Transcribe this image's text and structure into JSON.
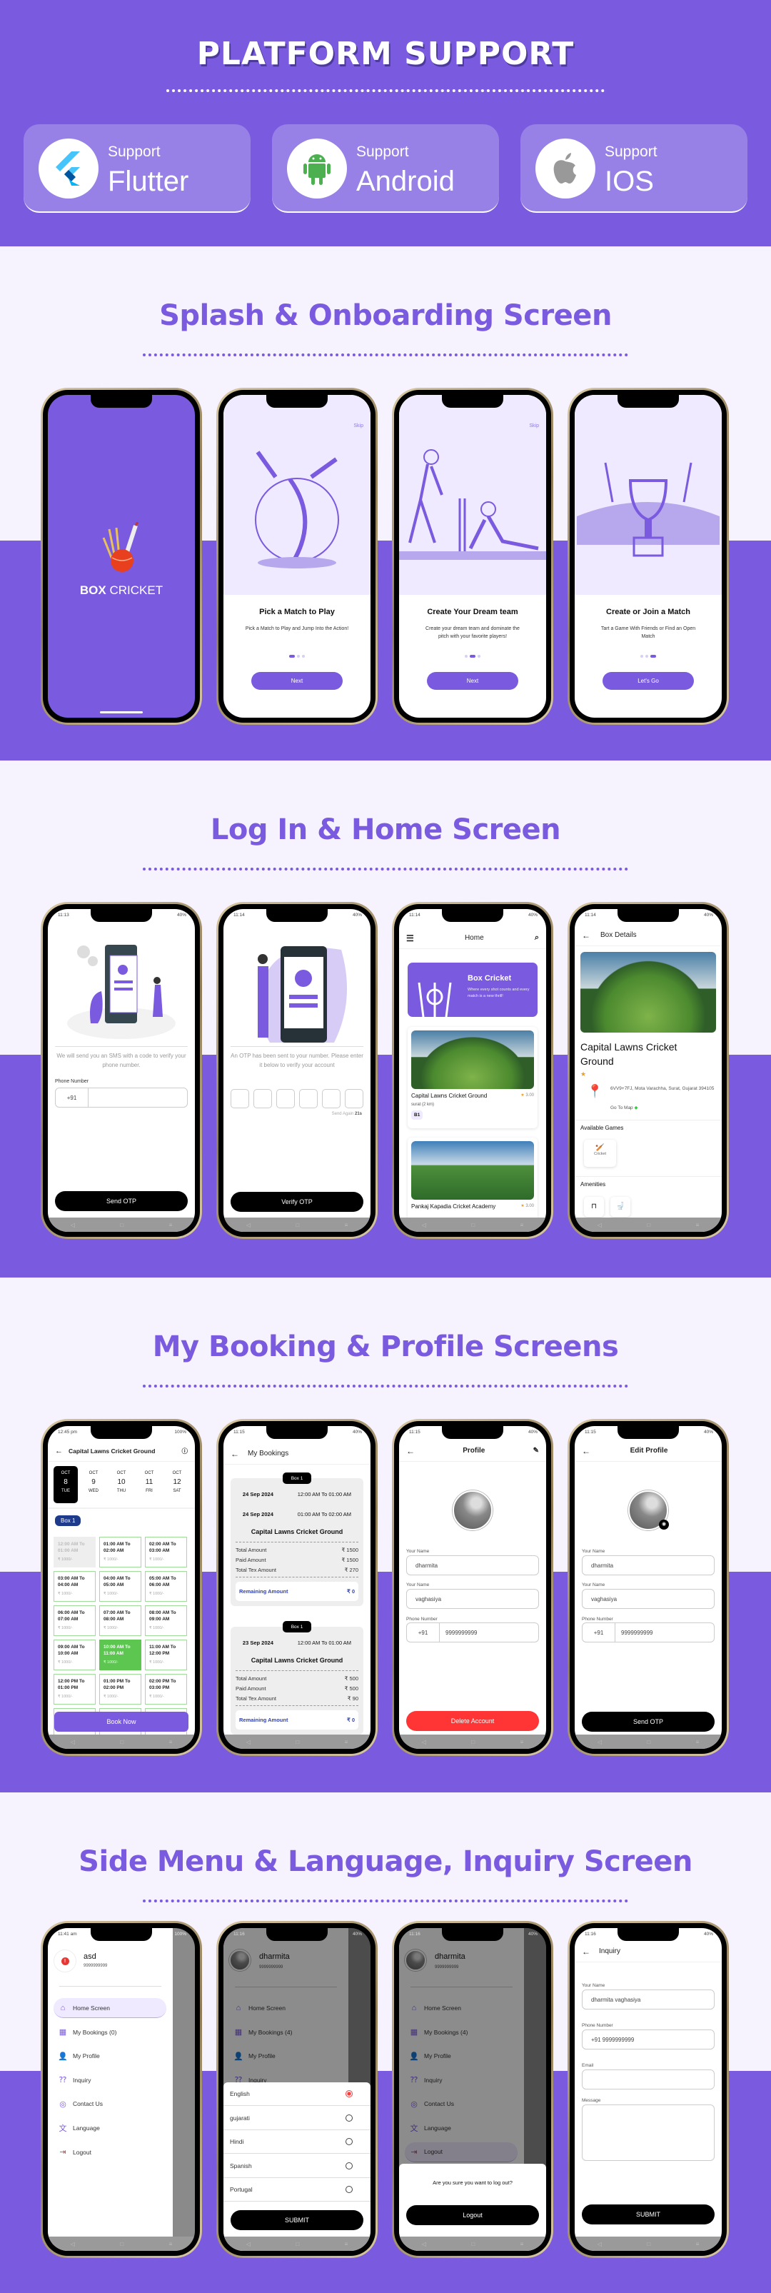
{
  "colors": {
    "primary": "#7a5ade",
    "light_bg": "#f6f3ff",
    "danger": "#ff3434",
    "slot_selected": "#5cc651"
  },
  "platform": {
    "title": "PLATFORM SUPPORT",
    "cards": [
      {
        "label": "Support",
        "name": "Flutter",
        "icon": "flutter-logo"
      },
      {
        "label": "Support",
        "name": "Android",
        "icon": "android-logo"
      },
      {
        "label": "Support",
        "name": "IOS",
        "icon": "apple-logo"
      }
    ]
  },
  "sections": [
    "Splash & Onboarding Screen",
    "Log In & Home Screen",
    "My Booking & Profile Screens",
    "Side Menu & Language, Inquiry Screen"
  ],
  "splash": {
    "brand_bold": "BOX",
    "brand_light": "CRICKET"
  },
  "onboarding": [
    {
      "skip": "Skip",
      "title": "Pick a Match to Play",
      "desc": "Pick a Match to Play and Jump Into the Action!",
      "button": "Next",
      "active_dot": 1
    },
    {
      "skip": "Skip",
      "title": "Create Your Dream team",
      "desc": "Create your dream team and dominate the pitch with your favorite players!",
      "button": "Next",
      "active_dot": 2
    },
    {
      "title": "Create or Join a Match",
      "desc": "Tart a Game With Friends or Find an Open Match",
      "button": "Let's Go",
      "active_dot": 3
    }
  ],
  "login": {
    "time": "11:13",
    "battery": "40%",
    "message": "We will send you an SMS with a code to verify your phone number.",
    "phone_label": "Phone Number",
    "country_code": "+91",
    "button": "Send OTP"
  },
  "otp": {
    "time": "11:14",
    "battery": "40%",
    "message": "An OTP has been sent to your number. Please enter it below to verify your account",
    "resend_label": "Send Again",
    "resend_timer": "21s",
    "button": "Verify OTP"
  },
  "home": {
    "time": "11:14",
    "battery": "40%",
    "title": "Home",
    "banner_title": "Box Cricket",
    "banner_text": "Where every shot counts and every match is a new thrill!",
    "grounds": [
      {
        "name": "Capital Lawns Cricket Ground",
        "rating": "3.00",
        "location": "surat (2 km)",
        "badge": "B1"
      },
      {
        "name": "Pankaj Kapadia Cricket Academy",
        "rating": "3.00"
      }
    ]
  },
  "box_details": {
    "time": "11:14",
    "battery": "40%",
    "title": "Box Details",
    "name": "Capital Lawns Cricket Ground",
    "address": "6VV9+7FJ, Mota Varachha, Surat, Gujarat 394105",
    "map_link": "Go To Map",
    "games_title": "Available Games",
    "game": "Cricket",
    "amenities_title": "Amenities"
  },
  "slots": {
    "time": "12:45 pm",
    "battery": "100%",
    "title": "Capital Lawns Cricket Ground",
    "dates": [
      {
        "month": "OCT",
        "day": "8",
        "weekday": "TUE",
        "selected": true
      },
      {
        "month": "OCT",
        "day": "9",
        "weekday": "WED"
      },
      {
        "month": "OCT",
        "day": "10",
        "weekday": "THU"
      },
      {
        "month": "OCT",
        "day": "11",
        "weekday": "FRI"
      },
      {
        "month": "OCT",
        "day": "12",
        "weekday": "SAT"
      }
    ],
    "box": "Box 1",
    "items": [
      {
        "label": "12:00 AM To 01:00 AM",
        "price": "₹ 1000/-",
        "state": "disabled"
      },
      {
        "label": "01:00 AM To 02:00 AM",
        "price": "₹ 1000/-"
      },
      {
        "label": "02:00 AM To 03:00 AM",
        "price": "₹ 1000/-"
      },
      {
        "label": "03:00 AM To 04:00 AM",
        "price": "₹ 1000/-"
      },
      {
        "label": "04:00 AM To 05:00 AM",
        "price": "₹ 1000/-"
      },
      {
        "label": "05:00 AM To 06:00 AM",
        "price": "₹ 1000/-"
      },
      {
        "label": "06:00 AM To 07:00 AM",
        "price": "₹ 1000/-"
      },
      {
        "label": "07:00 AM To 08:00 AM",
        "price": "₹ 1000/-"
      },
      {
        "label": "08:00 AM To 09:00 AM",
        "price": "₹ 1000/-"
      },
      {
        "label": "09:00 AM To 10:00 AM",
        "price": "₹ 1000/-"
      },
      {
        "label": "10:00 AM To 11:00 AM",
        "price": "₹ 1000/-",
        "state": "selected"
      },
      {
        "label": "11:00 AM To 12:00 PM",
        "price": "₹ 1000/-"
      },
      {
        "label": "12:00 PM To 01:00 PM",
        "price": "₹ 1000/-"
      },
      {
        "label": "01:00 PM To 02:00 PM",
        "price": "₹ 1000/-"
      },
      {
        "label": "02:00 PM To 03:00 PM",
        "price": "₹ 1000/-"
      }
    ],
    "button": "Book Now"
  },
  "bookings": {
    "time": "11:15",
    "battery": "40%",
    "title": "My Bookings",
    "cards": [
      {
        "box": "Box 1",
        "entries": [
          {
            "date": "24 Sep 2024",
            "time": "12:00 AM To 01:00 AM"
          },
          {
            "date": "24 Sep 2024",
            "time": "01:00 AM To 02:00 AM"
          }
        ],
        "ground": "Capital Lawns Cricket Ground",
        "rows": [
          {
            "label": "Total Amount",
            "value": "₹ 1500"
          },
          {
            "label": "Paid Amount",
            "value": "₹ 1500"
          },
          {
            "label": "Total Tex Amount",
            "value": "₹ 270"
          }
        ],
        "remaining_label": "Remaining Amount",
        "remaining": "₹ 0"
      },
      {
        "box": "Box 1",
        "entries": [
          {
            "date": "23 Sep 2024",
            "time": "12:00 AM To 01:00 AM"
          }
        ],
        "ground": "Capital Lawns Cricket Ground",
        "rows": [
          {
            "label": "Total Amount",
            "value": "₹ 500"
          },
          {
            "label": "Paid Amount",
            "value": "₹ 500"
          },
          {
            "label": "Total Tex Amount",
            "value": "₹ 90"
          }
        ],
        "remaining_label": "Remaining Amount",
        "remaining": "₹ 0"
      }
    ]
  },
  "profile": {
    "time": "11:15",
    "battery": "40%",
    "title": "Profile",
    "first_label": "Your Name",
    "first": "dharmita",
    "last_label": "Your Name",
    "last": "vaghasiya",
    "phone_label": "Phone Number",
    "code": "+91",
    "phone": "9999999999",
    "button": "Delete Account"
  },
  "edit_profile": {
    "time": "11:15",
    "battery": "40%",
    "title": "Edit Profile",
    "first_label": "Your Name",
    "first": "dharmita",
    "last_label": "Your Name",
    "last": "vaghasiya",
    "phone_label": "Phone Number",
    "code": "+91",
    "phone": "9999999999",
    "button": "Send OTP"
  },
  "side_menu": {
    "time": "11:41 am",
    "battery": "100%",
    "user": "asd",
    "phone": "9999999999",
    "items": [
      {
        "label": "Home Screen",
        "icon": "home-icon"
      },
      {
        "label": "My Bookings (0)",
        "icon": "calendar-icon"
      },
      {
        "label": "My Profile",
        "icon": "user-icon"
      },
      {
        "label": "Inquiry",
        "icon": "chat-question-icon"
      },
      {
        "label": "Contact Us",
        "icon": "headset-icon"
      },
      {
        "label": "Language",
        "icon": "translate-icon"
      },
      {
        "label": "Logout",
        "icon": "logout-icon"
      }
    ],
    "selected": 0
  },
  "language": {
    "time": "11:16",
    "battery": "40%",
    "user": "dharmita",
    "phone": "9999999999",
    "items": [
      {
        "label": "Home Screen",
        "icon": "home-icon"
      },
      {
        "label": "My Bookings (4)",
        "icon": "calendar-icon"
      },
      {
        "label": "My Profile",
        "icon": "user-icon"
      },
      {
        "label": "Inquiry",
        "icon": "chat-question-icon"
      }
    ],
    "options": [
      "English",
      "gujarati",
      "Hindi",
      "Spanish",
      "Portugal"
    ],
    "selected": "English",
    "button": "SUBMIT"
  },
  "logout": {
    "time": "11:16",
    "battery": "40%",
    "user": "dharmita",
    "phone": "9999999999",
    "items": [
      {
        "label": "Home Screen",
        "icon": "home-icon"
      },
      {
        "label": "My Bookings (4)",
        "icon": "calendar-icon"
      },
      {
        "label": "My Profile",
        "icon": "user-icon"
      },
      {
        "label": "Inquiry",
        "icon": "chat-question-icon"
      },
      {
        "label": "Contact Us",
        "icon": "headset-icon"
      },
      {
        "label": "Language",
        "icon": "translate-icon"
      },
      {
        "label": "Logout",
        "icon": "logout-icon"
      }
    ],
    "selected": 6,
    "question": "Are you sure you want to log out?",
    "button": "Logout"
  },
  "inquiry": {
    "time": "11:16",
    "battery": "40%",
    "title": "Inquiry",
    "name_label": "Your Name",
    "name": "dharmita vaghasiya",
    "phone_label": "Phone Number",
    "phone": "+91 9999999999",
    "email_label": "Email",
    "email": "",
    "message_label": "Message",
    "button": "SUBMIT"
  }
}
